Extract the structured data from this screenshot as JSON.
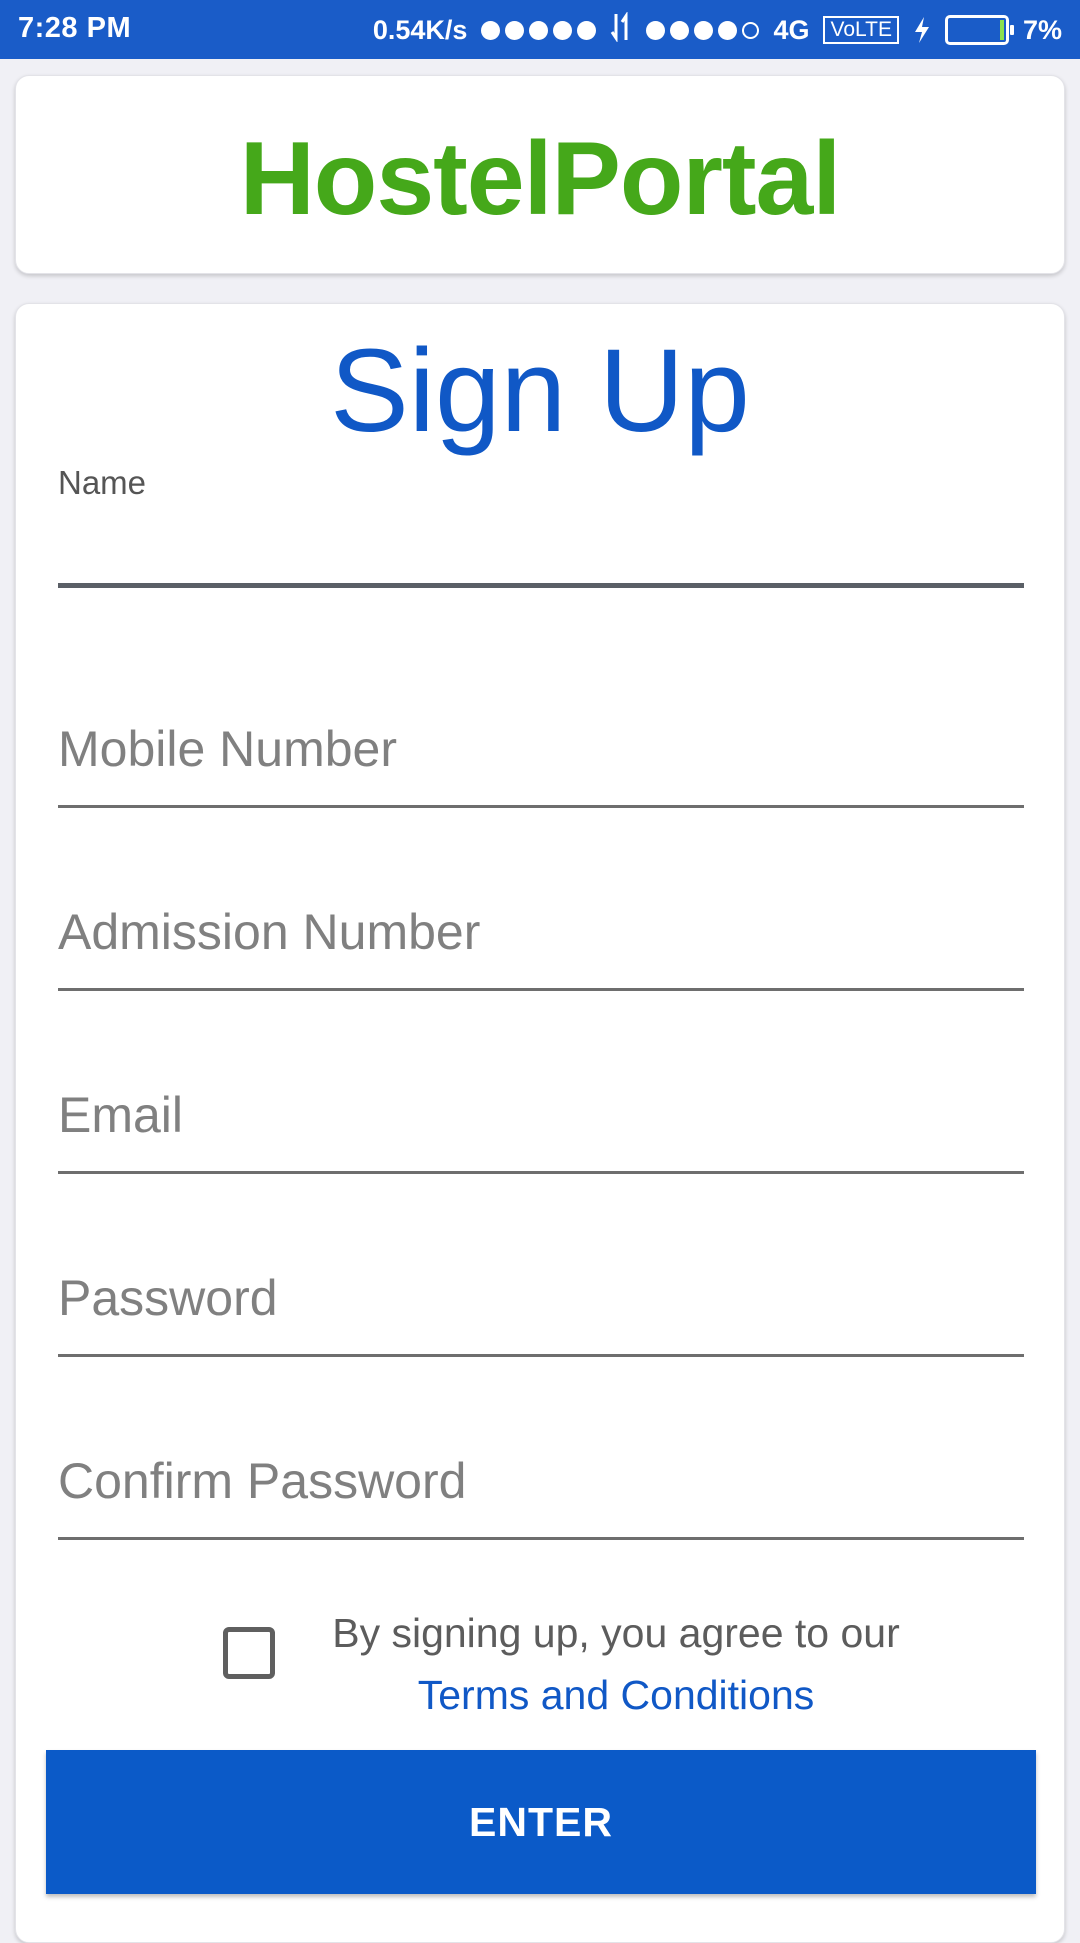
{
  "status_bar": {
    "time": "7:28 PM",
    "speed": "0.54K/s",
    "network": "4G",
    "volte": "VoLTE",
    "battery": "7%",
    "battery_level": 0.07,
    "signal1_bars": 5,
    "signal2_bars": 4
  },
  "header": {
    "brand": "HostelPortal",
    "brand_color": "#45a81a"
  },
  "form": {
    "title": "Sign Up",
    "title_color": "#1058c6",
    "fields": [
      {
        "label": "Name",
        "value": "",
        "placeholder": ""
      },
      {
        "placeholder": "Mobile Number",
        "value": ""
      },
      {
        "placeholder": "Admission Number",
        "value": ""
      },
      {
        "placeholder": "Email",
        "value": ""
      },
      {
        "placeholder": "Password",
        "value": ""
      },
      {
        "placeholder": "Confirm Password",
        "value": ""
      }
    ],
    "terms_text": "By signing up, you agree to our",
    "terms_link": "Terms and Conditions",
    "terms_checked": false,
    "submit_label": "ENTER",
    "submit_color": "#0b5ac8"
  }
}
